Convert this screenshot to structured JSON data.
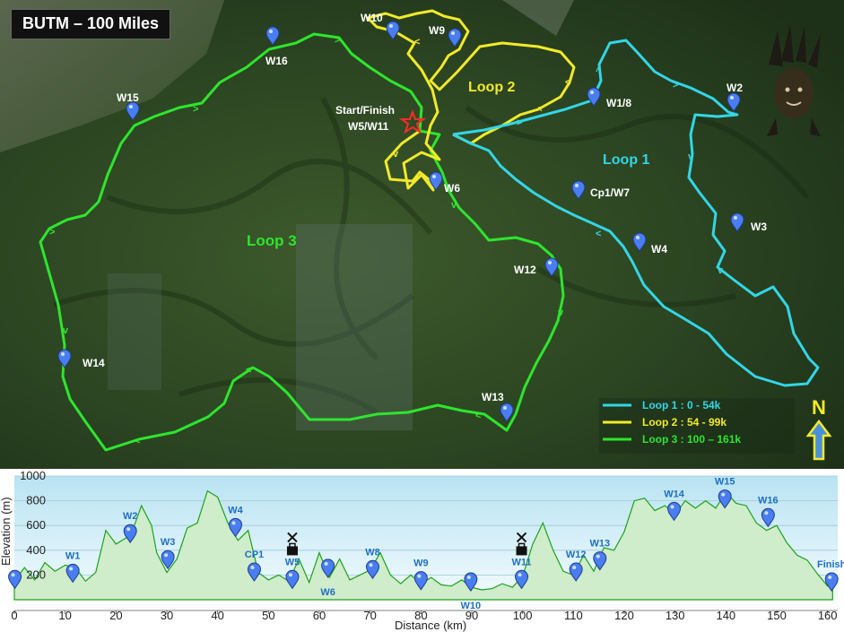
{
  "title": "BUTM – 100 Miles",
  "map": {
    "labels": {
      "start_finish": "Start/Finish",
      "start_finish_sub": "W5/W11",
      "loop1": "Loop 1",
      "loop2": "Loop 2",
      "loop3": "Loop 3",
      "north": "N"
    },
    "waypoints": [
      {
        "id": "w10",
        "label": "W10"
      },
      {
        "id": "w9",
        "label": "W9"
      },
      {
        "id": "w16",
        "label": "W16"
      },
      {
        "id": "w15",
        "label": "W15"
      },
      {
        "id": "w18",
        "label": "W1/8"
      },
      {
        "id": "w2",
        "label": "W2"
      },
      {
        "id": "cp1w7",
        "label": "Cp1/W7"
      },
      {
        "id": "w6",
        "label": "W6"
      },
      {
        "id": "w3",
        "label": "W3"
      },
      {
        "id": "w4",
        "label": "W4"
      },
      {
        "id": "w12",
        "label": "W12"
      },
      {
        "id": "w14",
        "label": "W14"
      },
      {
        "id": "w13",
        "label": "W13"
      }
    ],
    "legend": [
      {
        "label": "Loop 1 : 0 - 54k",
        "color": "#33d6e6"
      },
      {
        "label": "Loop 2 : 54 - 99k",
        "color": "#f2ea2a"
      },
      {
        "label": "Loop 3 : 100 – 161k",
        "color": "#2ee52e"
      }
    ],
    "colors": {
      "loop1": "#33d6e6",
      "loop2": "#f2ea2a",
      "loop3": "#2ee52e",
      "marker": "#4a7ef0"
    }
  },
  "chart_data": {
    "type": "area",
    "xlabel": "Distance (km)",
    "ylabel": "Elevation (m)",
    "xlim": [
      0,
      162
    ],
    "ylim": [
      0,
      1000
    ],
    "x_ticks": [
      0,
      10,
      20,
      30,
      40,
      50,
      60,
      70,
      80,
      90,
      100,
      110,
      120,
      130,
      140,
      150,
      160
    ],
    "y_ticks": [
      200,
      400,
      600,
      800,
      1000
    ],
    "grid": true,
    "x": [
      0,
      2,
      4,
      6,
      8,
      10,
      12,
      14,
      16,
      18,
      20,
      22,
      23,
      25,
      27,
      28,
      30,
      32,
      34,
      36,
      38,
      40,
      42,
      44,
      46,
      48,
      50,
      52,
      54,
      56,
      58,
      60,
      62,
      64,
      66,
      68,
      70,
      72,
      74,
      76,
      78,
      80,
      82,
      84,
      86,
      88,
      90,
      92,
      94,
      96,
      98,
      100,
      102,
      104,
      106,
      108,
      110,
      112,
      114,
      116,
      118,
      120,
      122,
      124,
      126,
      128,
      130,
      132,
      134,
      136,
      138,
      140,
      142,
      144,
      146,
      148,
      150,
      152,
      154,
      156,
      158,
      160,
      161
    ],
    "y": [
      150,
      260,
      160,
      300,
      230,
      280,
      260,
      150,
      220,
      560,
      450,
      500,
      530,
      760,
      600,
      380,
      220,
      330,
      580,
      620,
      880,
      830,
      620,
      480,
      560,
      220,
      160,
      200,
      150,
      330,
      140,
      380,
      180,
      330,
      160,
      200,
      240,
      380,
      200,
      130,
      200,
      130,
      180,
      120,
      110,
      160,
      100,
      80,
      90,
      130,
      100,
      190,
      450,
      620,
      400,
      230,
      200,
      360,
      230,
      420,
      400,
      550,
      800,
      820,
      720,
      760,
      690,
      800,
      740,
      800,
      740,
      870,
      780,
      760,
      620,
      560,
      600,
      460,
      360,
      320,
      210,
      110,
      130
    ],
    "waypoint_markers": [
      {
        "label": "W1",
        "x": 11.5,
        "y": 200
      },
      {
        "label": "W2",
        "x": 22.8,
        "y": 520
      },
      {
        "label": "W3",
        "x": 30.2,
        "y": 310
      },
      {
        "label": "W4",
        "x": 43.5,
        "y": 570
      },
      {
        "label": "CP1",
        "x": 47.2,
        "y": 210
      },
      {
        "label": "W5",
        "x": 54.7,
        "y": 150
      },
      {
        "label": "W6",
        "x": 61.7,
        "y": 240
      },
      {
        "label": "W8",
        "x": 70.5,
        "y": 230
      },
      {
        "label": "W9",
        "x": 80.0,
        "y": 140
      },
      {
        "label": "W10",
        "x": 89.8,
        "y": 130
      },
      {
        "label": "W11",
        "x": 99.8,
        "y": 150
      },
      {
        "label": "W12",
        "x": 110.5,
        "y": 210
      },
      {
        "label": "W13",
        "x": 115.2,
        "y": 300
      },
      {
        "label": "W14",
        "x": 129.8,
        "y": 700
      },
      {
        "label": "W15",
        "x": 139.8,
        "y": 800
      },
      {
        "label": "W16",
        "x": 148.3,
        "y": 650
      },
      {
        "label": "Finish",
        "x": 160.8,
        "y": 130
      },
      {
        "label": "",
        "x": 0.1,
        "y": 150
      }
    ],
    "aid_stations_km": [
      54.7,
      99.8
    ]
  }
}
